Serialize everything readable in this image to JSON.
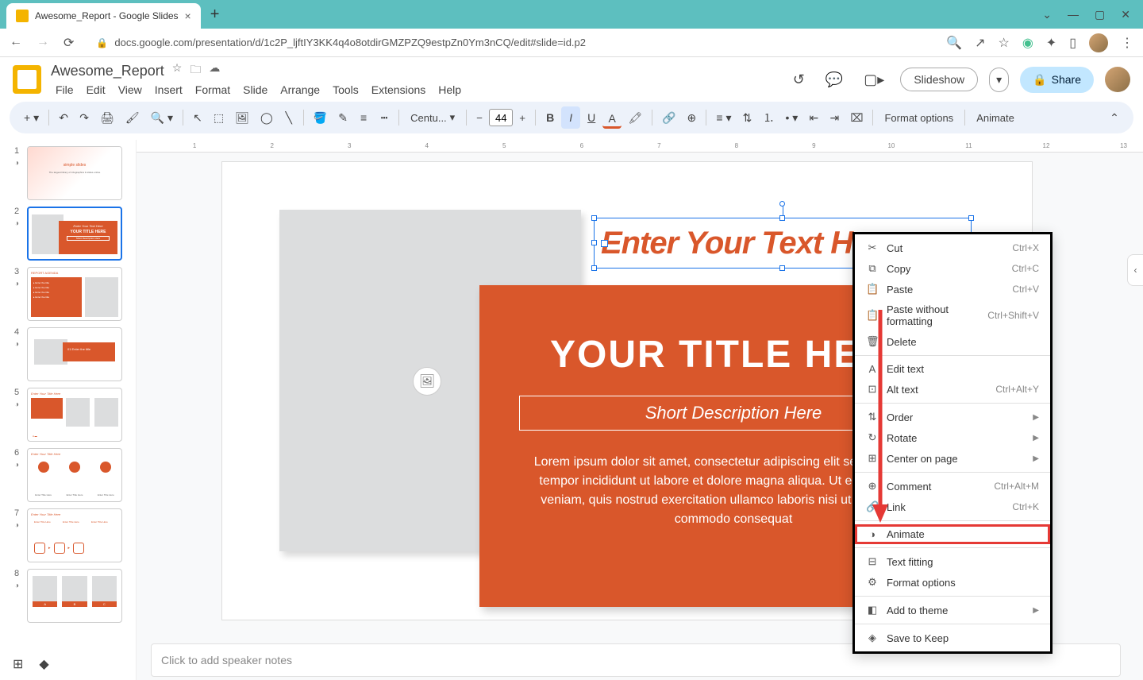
{
  "browser": {
    "tab_title": "Awesome_Report - Google Slides",
    "url": "docs.google.com/presentation/d/1c2P_ljftIY3KK4q4o8otdirGMZPZQ9estpZn0Ym3nCQ/edit#slide=id.p2"
  },
  "doc": {
    "title": "Awesome_Report",
    "menus": [
      "File",
      "Edit",
      "View",
      "Insert",
      "Format",
      "Slide",
      "Arrange",
      "Tools",
      "Extensions",
      "Help"
    ]
  },
  "header_buttons": {
    "slideshow": "Slideshow",
    "share": "Share"
  },
  "toolbar": {
    "font": "Centu...",
    "font_size": "44",
    "format_options": "Format options",
    "animate": "Animate"
  },
  "slides": [
    {
      "num": "1"
    },
    {
      "num": "2",
      "selected": true
    },
    {
      "num": "3"
    },
    {
      "num": "4"
    },
    {
      "num": "5"
    },
    {
      "num": "6"
    },
    {
      "num": "7"
    },
    {
      "num": "8"
    }
  ],
  "canvas": {
    "selected_text": "Enter Your Text Here",
    "title": "YOUR TITLE HERE",
    "subtitle": "Short Description Here",
    "body": "Lorem ipsum dolor sit amet, consectetur adipiscing elit sed do eiusmod tempor incididunt ut labore et dolore magna aliqua. Ut enim ad minim veniam, quis nostrud exercitation ullamco laboris nisi ut aliquip ex ea commodo consequat"
  },
  "notes_placeholder": "Click to add speaker notes",
  "context_menu": [
    {
      "icon": "✂",
      "label": "Cut",
      "shortcut": "Ctrl+X"
    },
    {
      "icon": "⧉",
      "label": "Copy",
      "shortcut": "Ctrl+C"
    },
    {
      "icon": "📋",
      "label": "Paste",
      "shortcut": "Ctrl+V"
    },
    {
      "icon": "📋",
      "label": "Paste without formatting",
      "shortcut": "Ctrl+Shift+V"
    },
    {
      "icon": "🗑",
      "label": "Delete"
    },
    {
      "sep": true
    },
    {
      "icon": "A",
      "label": "Edit text"
    },
    {
      "icon": "⊡",
      "label": "Alt text",
      "shortcut": "Ctrl+Alt+Y"
    },
    {
      "sep": true
    },
    {
      "icon": "⇅",
      "label": "Order",
      "submenu": true
    },
    {
      "icon": "↻",
      "label": "Rotate",
      "submenu": true
    },
    {
      "icon": "⊞",
      "label": "Center on page",
      "submenu": true
    },
    {
      "sep": true
    },
    {
      "icon": "⊕",
      "label": "Comment",
      "shortcut": "Ctrl+Alt+M"
    },
    {
      "icon": "🔗",
      "label": "Link",
      "shortcut": "Ctrl+K"
    },
    {
      "sep": true
    },
    {
      "icon": "◑",
      "label": "Animate",
      "highlight": true
    },
    {
      "sep": true
    },
    {
      "icon": "⊟",
      "label": "Text fitting"
    },
    {
      "icon": "⚙",
      "label": "Format options"
    },
    {
      "sep": true
    },
    {
      "icon": "◧",
      "label": "Add to theme",
      "submenu": true
    },
    {
      "sep": true
    },
    {
      "icon": "◈",
      "label": "Save to Keep"
    }
  ],
  "ruler_marks": [
    "",
    "1",
    "",
    "2",
    "",
    "3",
    "",
    "4",
    "",
    "5",
    "",
    "6",
    "",
    "7",
    "",
    "8",
    "",
    "9",
    "",
    "10",
    "",
    "11",
    "",
    "12",
    "",
    "13"
  ]
}
